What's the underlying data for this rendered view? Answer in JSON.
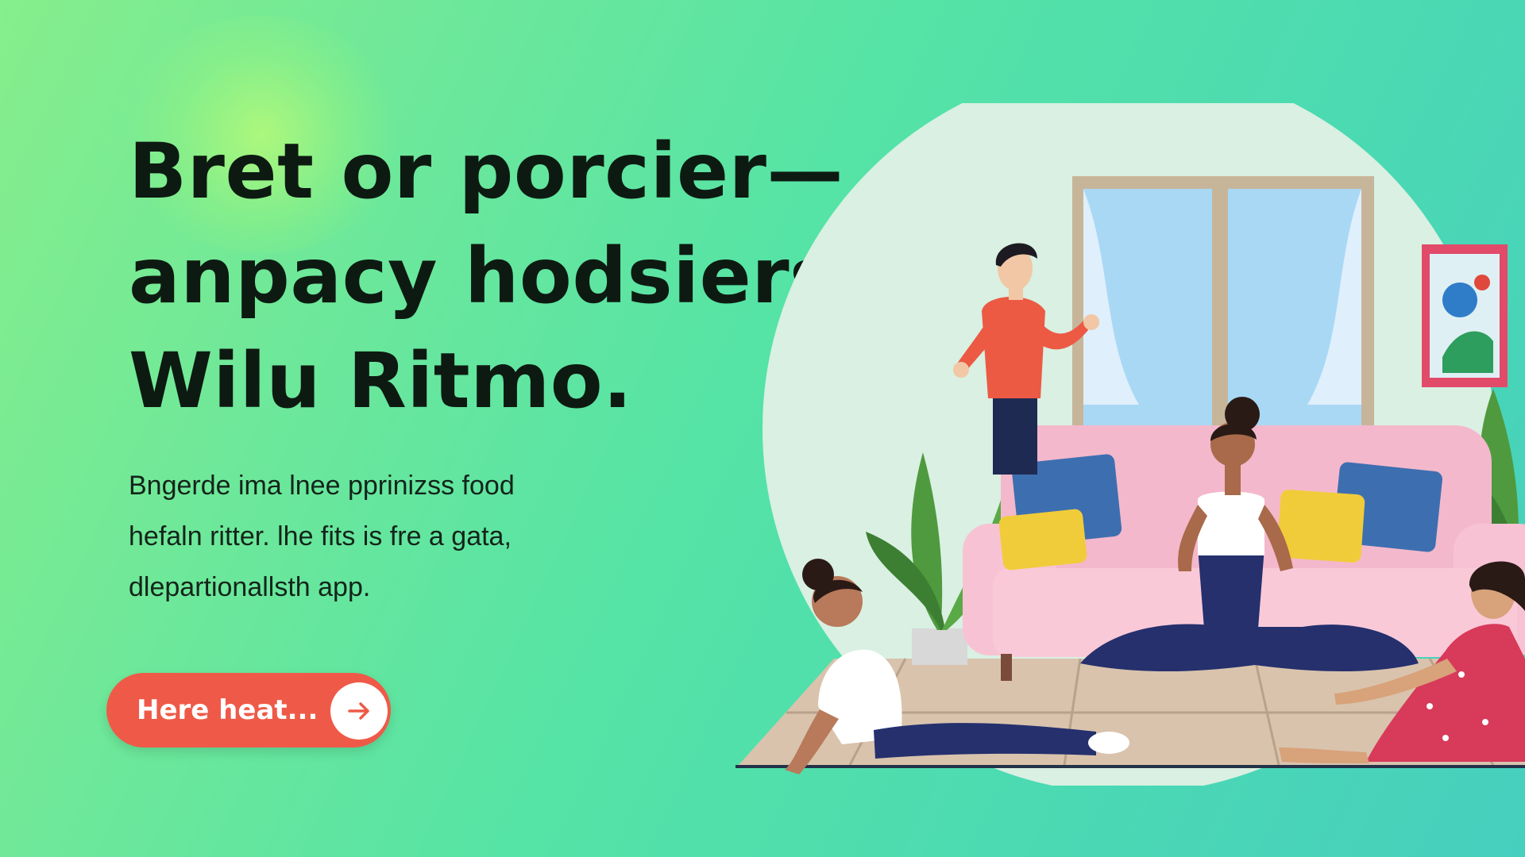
{
  "hero": {
    "headline_lines": [
      "Bret or porcier—",
      "anpacy hodsiers",
      "Wilu Ritmo."
    ],
    "subtext_lines": [
      "Bngerde ima lnee pprinizss food",
      "hefaln ritter. lhe fits is fre a gata,",
      "dlepartionallsth app."
    ]
  },
  "cta": {
    "label": "Here heat...",
    "icon": "arrow-right-icon"
  },
  "colors": {
    "accent": "#ef5a48",
    "headline": "#0d1a12",
    "background_start": "#86ee8c",
    "background_end": "#46cfbe"
  }
}
